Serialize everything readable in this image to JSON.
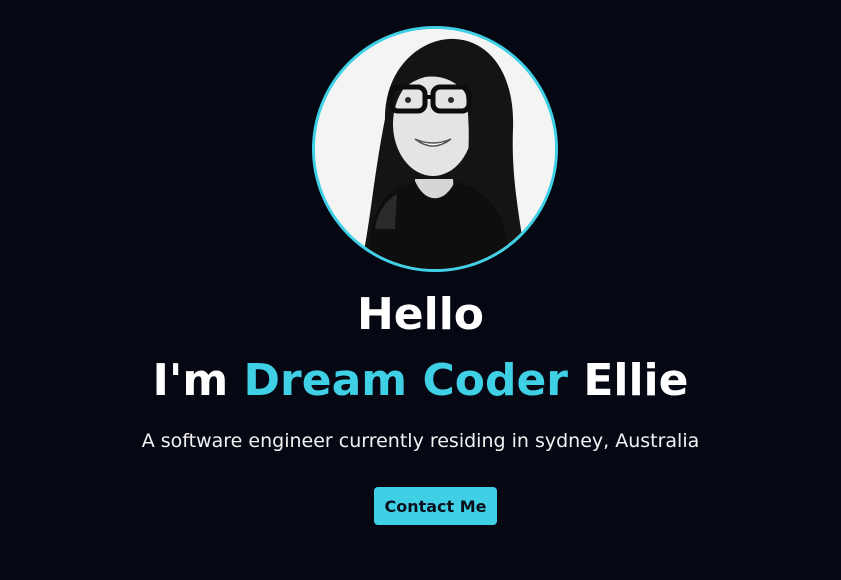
{
  "hero": {
    "greeting": "Hello",
    "intro_prefix": "I'm ",
    "intro_highlight": "Dream Coder",
    "intro_suffix": " Ellie",
    "description": "A software engineer currently residing in sydney, Australia",
    "contact_label": "Contact Me"
  },
  "colors": {
    "background": "#050813",
    "accent": "#3fd0e6",
    "text": "#ffffff"
  }
}
